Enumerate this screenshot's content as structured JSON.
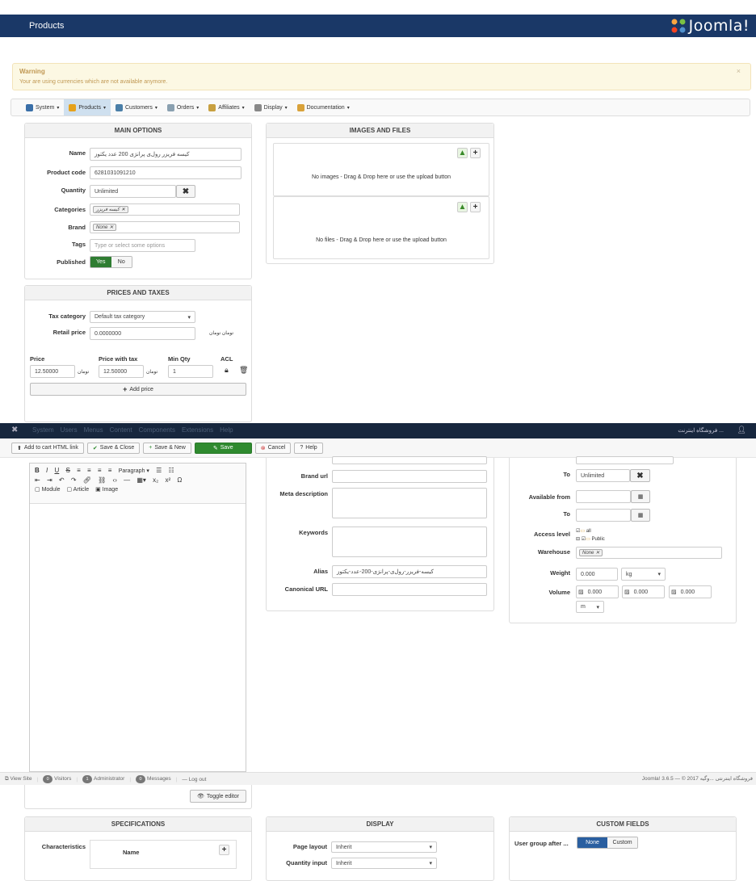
{
  "header": {
    "title": "Products",
    "logo_text": "Joomla!"
  },
  "warning": {
    "heading": "Warning",
    "text": "Your are using currencies which are not available anymore.",
    "close": "×"
  },
  "menubar": [
    {
      "label": "System",
      "icon": "wrench-icon",
      "color": "#3a6fa8"
    },
    {
      "label": "Products",
      "icon": "product-icon",
      "color": "#e6a21c",
      "active": true
    },
    {
      "label": "Customers",
      "icon": "customers-icon",
      "color": "#4b7fa8"
    },
    {
      "label": "Orders",
      "icon": "orders-icon",
      "color": "#8aa0b0"
    },
    {
      "label": "Affiliates",
      "icon": "affiliates-icon",
      "color": "#c8a040"
    },
    {
      "label": "Display",
      "icon": "display-icon",
      "color": "#888"
    },
    {
      "label": "Documentation",
      "icon": "docs-icon",
      "color": "#d9a23a"
    }
  ],
  "main_options": {
    "title": "MAIN OPTIONS",
    "name_label": "Name",
    "name_value": "کیسه فریزر رول‌ی پرانژی 200 عدد یکتوز",
    "code_label": "Product code",
    "code_value": "6281031091210",
    "qty_label": "Quantity",
    "qty_value": "Unlimited",
    "qty_clear": "✖",
    "cat_label": "Categories",
    "cat_tag": "کیسه فریزر",
    "brand_label": "Brand",
    "brand_tag": "None",
    "tags_label": "Tags",
    "tags_placeholder": "Type or select some options",
    "pub_label": "Published",
    "pub_yes": "Yes",
    "pub_no": "No"
  },
  "images": {
    "title": "IMAGES AND FILES",
    "no_images": "No images - Drag & Drop here or use the upload button",
    "no_files": "No files - Drag & Drop here or use the upload button"
  },
  "prices": {
    "title": "PRICES AND TAXES",
    "tax_label": "Tax category",
    "tax_value": "Default tax category",
    "retail_label": "Retail price",
    "retail_value": "0.0000000",
    "retail_unit": "تومان تومان",
    "col_price": "Price",
    "col_with_tax": "Price with tax",
    "col_min_qty": "Min Qty",
    "col_acl": "ACL",
    "price_value": "12.50000",
    "price_unit": "تومان",
    "with_tax_value": "12.50000",
    "with_tax_unit": "تومان",
    "min_qty_value": "1",
    "add_price": "Add price"
  },
  "adminbar": {
    "items": [
      "System",
      "Users",
      "Menus",
      "Content",
      "Components",
      "Extensions",
      "Help"
    ],
    "site": "فروشگاه اینترنت ..."
  },
  "toolbar": {
    "html_link": "Add to cart HTML link",
    "save_close": "Save & Close",
    "save_new": "Save & New",
    "save": "Save",
    "cancel": "Cancel",
    "help": "Help"
  },
  "editor": {
    "paragraph": "Paragraph",
    "module": "Module",
    "article": "Article",
    "image": "Image",
    "toggle": "Toggle editor"
  },
  "meta": {
    "brand_url_label": "Brand url",
    "meta_desc_label": "Meta description",
    "keywords_label": "Keywords",
    "alias_label": "Alias",
    "alias_value": "کیسه-فریزر-رول‌ی-پرانژی-200-عدد-یکتوز",
    "canonical_label": "Canonical URL"
  },
  "right": {
    "to_label": "To",
    "to_value": "Unlimited",
    "to_clear": "✖",
    "avail_from_label": "Available from",
    "avail_to_label": "To",
    "access_label": "Access level",
    "access_all": "all",
    "access_public": "Public",
    "warehouse_label": "Warehouse",
    "warehouse_tag": "None",
    "weight_label": "Weight",
    "weight_value": "0.000",
    "weight_unit": "kg",
    "volume_label": "Volume",
    "vol1": "0.000",
    "vol2": "0.000",
    "vol3": "0.000",
    "vol_unit": "m"
  },
  "statusbar": {
    "view_site": "View Site",
    "visitors_count": "0",
    "visitors": "Visitors",
    "admin_count": "1",
    "admin": "Administrator",
    "msg_count": "0",
    "messages": "Messages",
    "logout": "Log out",
    "right": "Joomla! 3.6.5 — © 2017 فروشگاه اینترنتی ...وگیه"
  },
  "specs": {
    "title": "SPECIFICATIONS",
    "char_label": "Characteristics",
    "name_col": "Name"
  },
  "display": {
    "title": "DISPLAY",
    "page_layout_label": "Page layout",
    "page_layout_value": "Inherit",
    "qty_input_label": "Quantity input",
    "qty_input_value": "Inherit"
  },
  "custom": {
    "title": "CUSTOM FIELDS",
    "ug_label": "User group after ...",
    "none": "None",
    "custom": "Custom"
  }
}
